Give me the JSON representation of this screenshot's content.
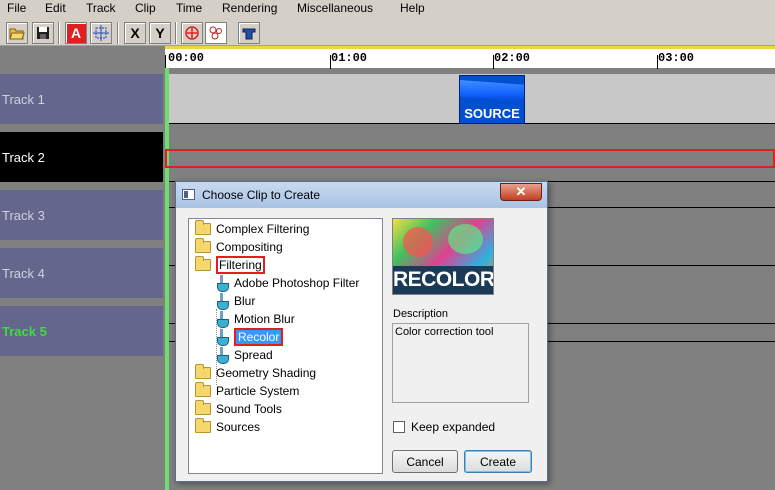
{
  "menu": [
    "File",
    "Edit",
    "Track",
    "Clip",
    "Time",
    "Rendering",
    "Miscellaneous",
    "Help"
  ],
  "toolbar": {
    "x_label": "X",
    "y_label": "Y",
    "a_label": "A"
  },
  "ruler": {
    "ticks": [
      "00:00",
      "01:00",
      "02:00",
      "03:00"
    ]
  },
  "tracks": [
    "Track 1",
    "Track 2",
    "Track 3",
    "Track 4",
    "Track 5"
  ],
  "clip": {
    "label": "SOURCE"
  },
  "dialog": {
    "title": "Choose Clip to Create",
    "close": "✕",
    "tree": [
      "Complex Filtering",
      "Compositing",
      "Filtering",
      "Adobe Photoshop Filter",
      "Blur",
      "Motion Blur",
      "Recolor",
      "Spread",
      "Geometry Shading",
      "Particle System",
      "Sound Tools",
      "Sources"
    ],
    "preview_label": "RECOLOR",
    "description_label": "Description",
    "description_text": "Color correction tool",
    "keep_expanded": "Keep expanded",
    "cancel": "Cancel",
    "create": "Create"
  },
  "colors": {
    "track_label_bg": "#65668c",
    "selected_track_bg": "#000000",
    "track5_text": "#3ddc3d",
    "highlight": "#e02020",
    "selection": "#3399ff"
  }
}
